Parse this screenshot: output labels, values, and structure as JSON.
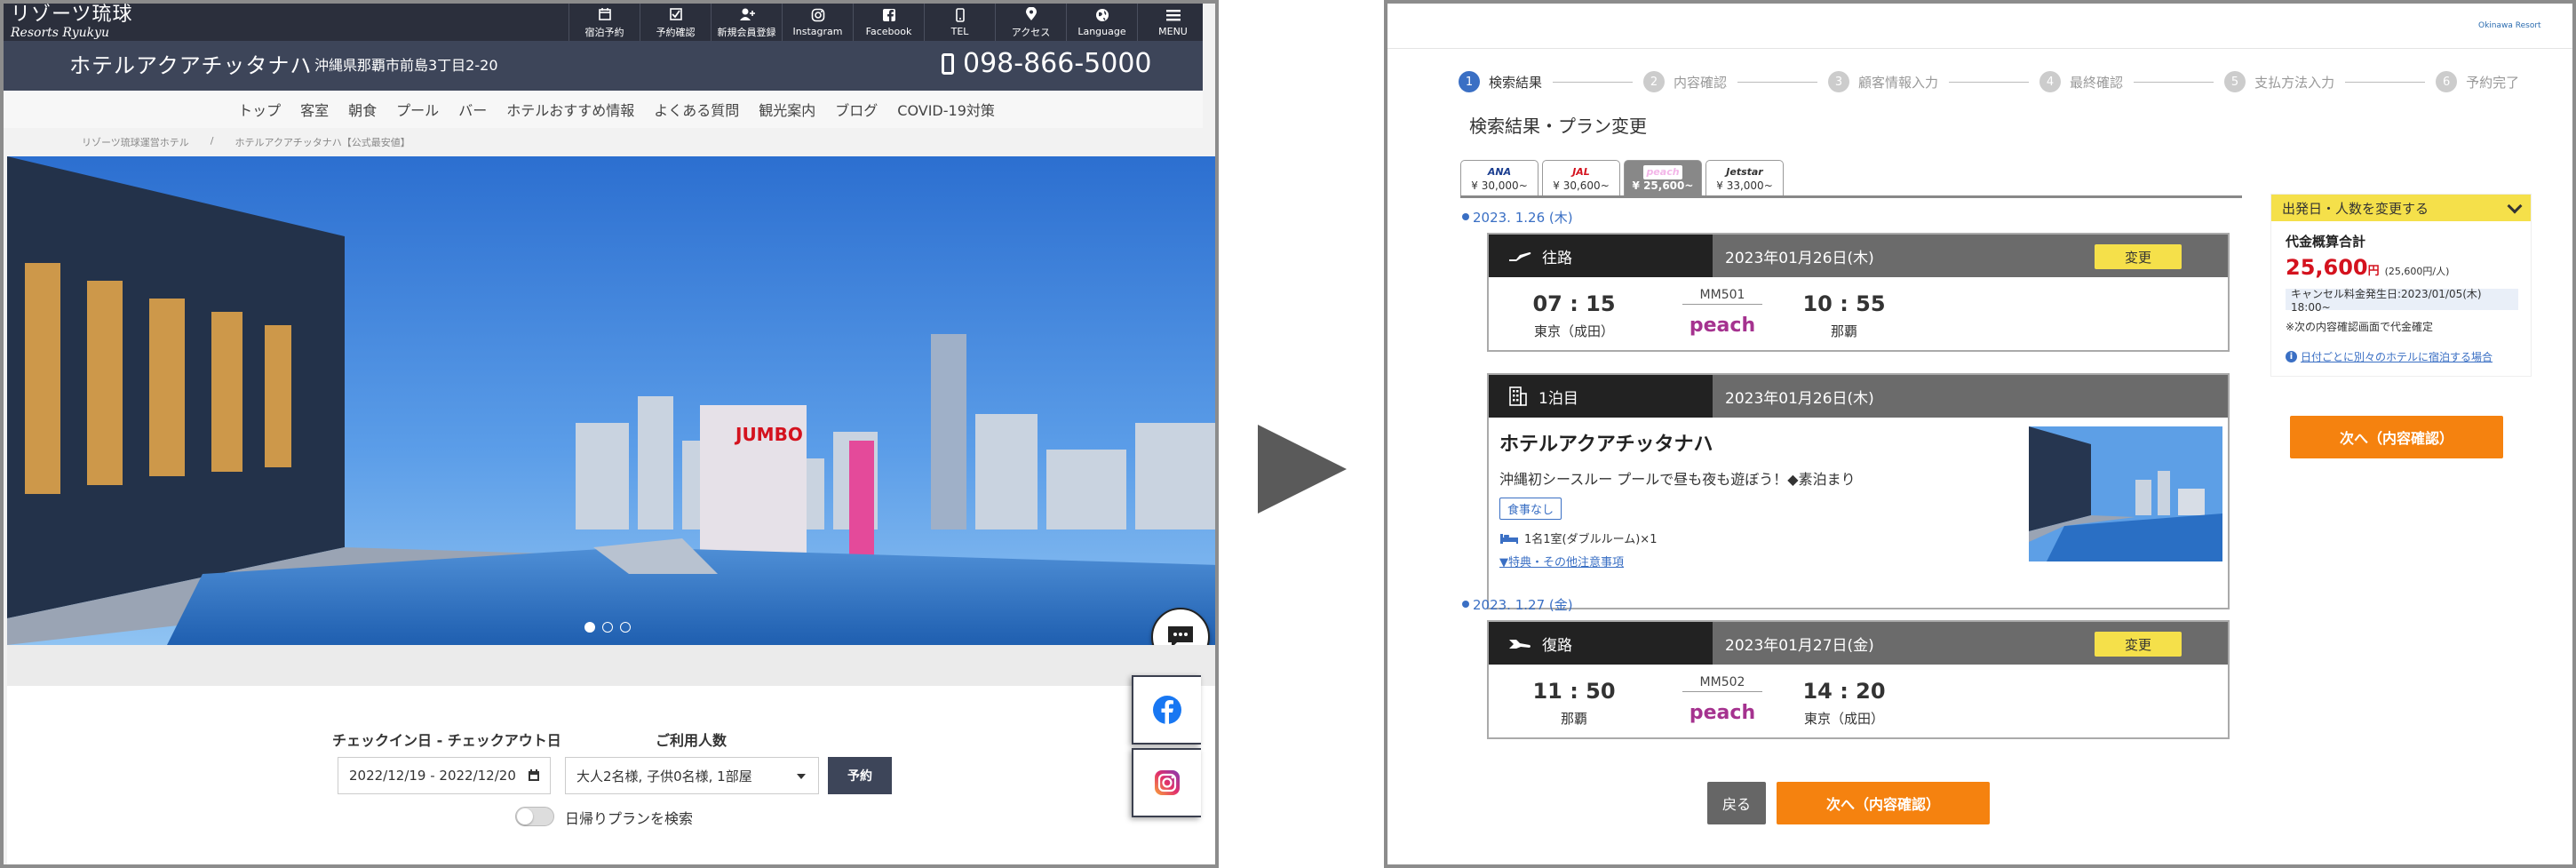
{
  "left": {
    "logo": {
      "line1": "リゾーツ琉球",
      "line2": "Resorts Ryukyu"
    },
    "topnav": [
      {
        "label": "宿泊予約",
        "icon": "calendar-icon"
      },
      {
        "label": "予約確認",
        "icon": "check-icon"
      },
      {
        "label": "新規会員登録",
        "icon": "user-add-icon"
      },
      {
        "label": "Instagram",
        "icon": "instagram-icon"
      },
      {
        "label": "Facebook",
        "icon": "facebook-icon"
      },
      {
        "label": "TEL",
        "icon": "phone-icon"
      },
      {
        "label": "アクセス",
        "icon": "pin-icon"
      },
      {
        "label": "Language",
        "icon": "globe-icon"
      },
      {
        "label": "MENU",
        "icon": "menu-icon"
      }
    ],
    "hotel": {
      "name": "ホテルアクアチッタナハ",
      "address": "沖縄県那覇市前島3丁目2-20",
      "tel": "098-866-5000"
    },
    "menu": [
      "トップ",
      "客室",
      "朝食",
      "プール",
      "バー",
      "ホテルおすすめ情報",
      "よくある質問",
      "観光案内",
      "ブログ",
      "COVID-19対策"
    ],
    "breadcrumb": [
      "リゾーツ琉球運営ホテル",
      "/",
      "ホテルアクアチッタナハ【公式最安値】"
    ],
    "hero_sign": "JUMBO",
    "booking": {
      "date_label": "チェックイン日 - チェックアウト日",
      "date_value": "2022/12/19 - 2022/12/20",
      "guests_label": "ご利用人数",
      "guests_value": "大人2名様, 子供0名様, 1部屋",
      "reserve_button": "予約",
      "dayuse_label": "日帰りプランを検索"
    }
  },
  "right": {
    "brand": "Okinawa Resort",
    "steps": [
      {
        "num": "1",
        "label": "検索結果",
        "active": true
      },
      {
        "num": "2",
        "label": "内容確認",
        "active": false
      },
      {
        "num": "3",
        "label": "顧客情報入力",
        "active": false
      },
      {
        "num": "4",
        "label": "最終確認",
        "active": false
      },
      {
        "num": "5",
        "label": "支払方法入力",
        "active": false
      },
      {
        "num": "6",
        "label": "予約完了",
        "active": false
      }
    ],
    "page_title": "検索結果・プラン変更",
    "tabs": [
      {
        "carrier": "ANA",
        "price": "¥ 30,000~",
        "color": "#1a3d8f",
        "active": false
      },
      {
        "carrier": "JAL",
        "price": "¥ 30,600~",
        "color": "#d4121e",
        "active": false
      },
      {
        "carrier": "peach",
        "price": "¥ 25,600~",
        "color": "#a5328f",
        "active": true
      },
      {
        "carrier": "Jetstar",
        "price": "¥ 33,000~",
        "color": "#333333",
        "active": false
      }
    ],
    "day1_date": "2023. 1.26 (木)",
    "outbound": {
      "type": "往路",
      "date": "2023年01月26日(木)",
      "change": "変更",
      "dep_time": "07 : 15",
      "dep_place": "東京（成田）",
      "flight_no": "MM501",
      "airline": "peach",
      "arr_time": "10 : 55",
      "arr_place": "那覇"
    },
    "stay": {
      "type": "1泊目",
      "date": "2023年01月26日(木)",
      "hotel_name": "ホテルアクアチッタナハ",
      "desc": "沖縄初シースルー プールで昼も夜も遊ぼう！◆素泊まり",
      "meal": "食事なし",
      "room": "1名1室(ダブルルーム)×1",
      "link": "▼特典・その他注意事項"
    },
    "day2_date": "2023. 1.27 (金)",
    "inbound": {
      "type": "復路",
      "date": "2023年01月27日(金)",
      "change": "変更",
      "dep_time": "11 : 50",
      "dep_place": "那覇",
      "flight_no": "MM502",
      "airline": "peach",
      "arr_time": "14 : 20",
      "arr_place": "東京（成田）"
    },
    "side": {
      "header": "出発日・人数を変更する",
      "total_label": "代金概算合計",
      "total": "25,600",
      "yen": "円",
      "per_person": "(25,600円/人)",
      "cancel": "キャンセル料金発生日:2023/01/05(木) 18:00~",
      "note": "※次の内容確認画面で代金確定",
      "link": "日付ごとに別々のホテルに宿泊する場合"
    },
    "next_button": "次へ（内容確認）",
    "back_button": "戻る"
  }
}
